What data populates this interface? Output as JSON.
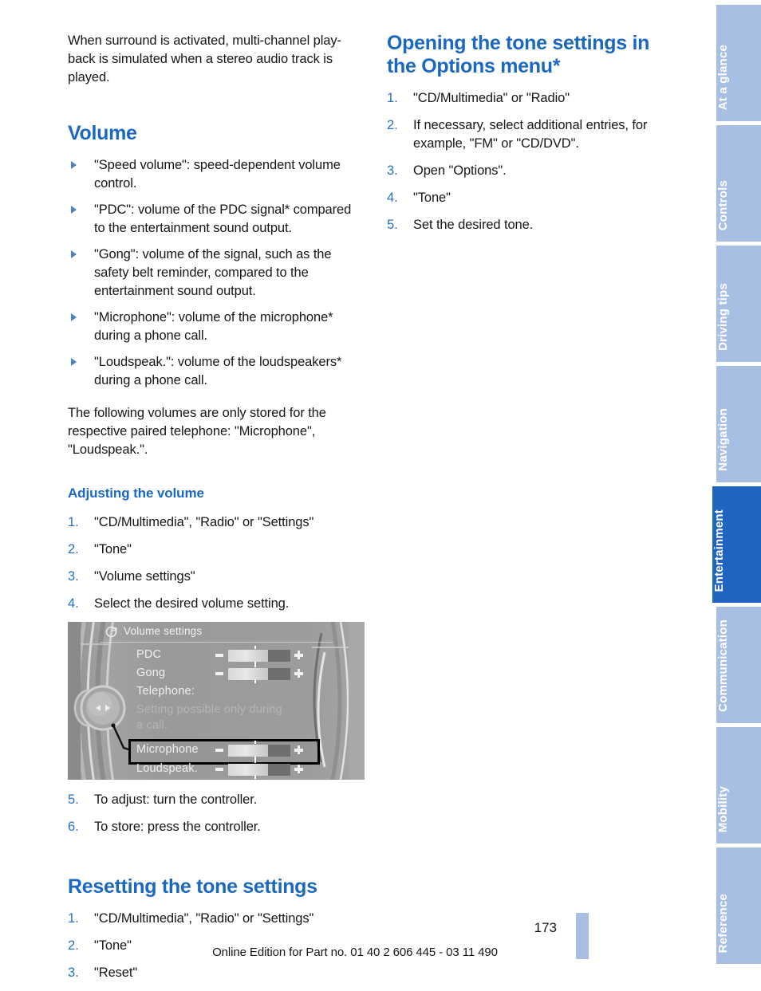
{
  "document": {
    "page_number": "173",
    "footer": "Online Edition for Part no. 01 40 2 606 445 - 03 11 490"
  },
  "left_column": {
    "intro_paragraph": "When surround is activated, multi-channel play-back is simulated when a stereo audio track is played.",
    "volume_heading": "Volume",
    "volume_bullets": [
      "\"Speed volume\": speed-dependent volume control.",
      "\"PDC\": volume of the PDC signal* compared to the entertainment sound output.",
      "\"Gong\": volume of the signal, such as the safety belt reminder, compared to the entertainment sound output.",
      "\"Microphone\": volume of the microphone* during a phone call.",
      "\"Loudspeak.\": volume of the loudspeakers* during a phone call."
    ],
    "note_paragraph": "The following volumes are only stored for the respective paired telephone: \"Microphone\", \"Loudspeak.\".",
    "adjusting_heading": "Adjusting the volume",
    "adjusting_steps": [
      "\"CD/Multimedia\", \"Radio\" or \"Settings\"",
      "\"Tone\"",
      "\"Volume settings\"",
      "Select the desired volume setting."
    ],
    "adjusting_steps_after": [
      "To adjust: turn the controller.",
      "To store: press the controller."
    ],
    "resetting_heading": "Resetting the tone settings",
    "resetting_steps": [
      "\"CD/Multimedia\", \"Radio\" or \"Settings\"",
      "\"Tone\"",
      "\"Reset\""
    ]
  },
  "right_column": {
    "opening_heading": "Opening the tone settings in the Options menu*",
    "opening_steps": [
      "\"CD/Multimedia\" or \"Radio\"",
      "If necessary, select additional entries, for example, \"FM\" or \"CD/DVD\".",
      "Open \"Options\".",
      "\"Tone\"",
      "Set the desired tone."
    ]
  },
  "figure": {
    "icon_name": "speaker-note-icon",
    "title": "Volume settings",
    "rows": [
      {
        "label": "PDC",
        "type": "slider",
        "value": 64
      },
      {
        "label": "Gong",
        "type": "slider",
        "value": 64
      },
      {
        "label": "Telephone:",
        "type": "label"
      },
      {
        "label": "Setting possible only during",
        "type": "label-dim"
      },
      {
        "label": "a call.",
        "type": "label-dim"
      },
      {
        "label": "Microphone",
        "type": "slider",
        "value": 64,
        "highlighted": true
      },
      {
        "label": "Loudspeak.",
        "type": "slider",
        "value": 64
      }
    ],
    "controller_icon": "idrive-controller-icon"
  },
  "tabs": [
    {
      "label": "At a glance",
      "active": false
    },
    {
      "label": "Controls",
      "active": false
    },
    {
      "label": "Driving tips",
      "active": false
    },
    {
      "label": "Navigation",
      "active": false
    },
    {
      "label": "Entertainment",
      "active": true
    },
    {
      "label": "Communication",
      "active": false
    },
    {
      "label": "Mobility",
      "active": false
    },
    {
      "label": "Reference",
      "active": false
    }
  ],
  "colors": {
    "heading_blue": "#1b68c0",
    "tab_inactive": "#a8bfe4",
    "tab_active": "#1f64c0",
    "list_number": "#2472c4"
  }
}
